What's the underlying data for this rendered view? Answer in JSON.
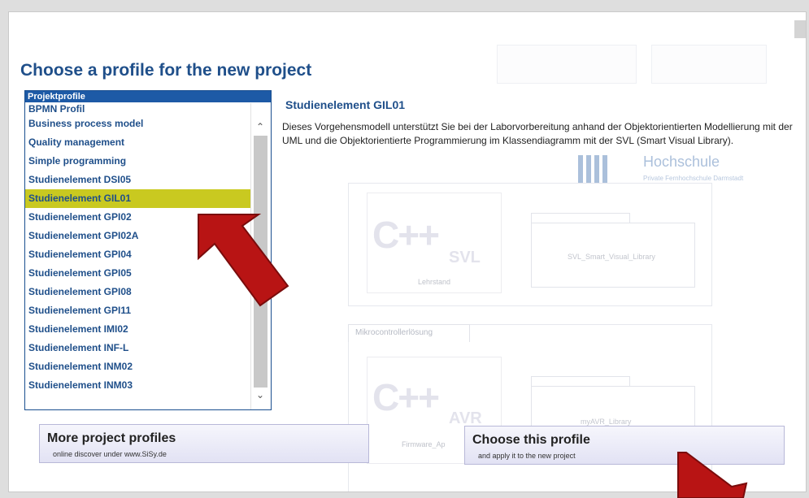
{
  "dialog": {
    "title": "Choose a profile for the new project"
  },
  "profile_list": {
    "header": "Projektprofile",
    "items": [
      "BPMN Profil",
      "Business process model",
      "Quality management",
      "Simple programming",
      "Studienelement DSI05",
      "Studienelement GIL01",
      "Studienelement GPI02",
      "Studienelement GPI02A",
      "Studienelement GPI04",
      "Studienelement GPI05",
      "Studienelement GPI08",
      "Studienelement GPI11",
      "Studienelement IMI02",
      "Studienelement INF-L",
      "Studienelement INM02",
      "Studienelement INM03"
    ],
    "selected": "Studienelement GIL01"
  },
  "detail": {
    "title": "Studienelement GIL01",
    "description": "Dieses Vorgehensmodell unterstützt Sie bei der Laborvorbereitung anhand der Objektorientierten Modellierung mit der UML und die Objektorientierte Programmierung im Klassendiagramm mit der SVL (Smart Visual Library)."
  },
  "watermark": {
    "name": "Hochschule",
    "subtitle": "Private Fernhochschule Darmstadt"
  },
  "preview": {
    "group2_tab": "Mikrocontrollerlösung",
    "tile1_label": "Lehrstand",
    "tile1_sub": "SVL",
    "folder1_label": "SVL_Smart_Visual_Library",
    "tile2_label": "Firmware_Ap",
    "tile2_sub": "AVR",
    "folder2_label": "myAVR_Library",
    "logo_text": "C++"
  },
  "buttons": {
    "more_profiles": {
      "label": "More project profiles",
      "sub": "online discover under www.SiSy.de"
    },
    "choose_profile": {
      "label": "Choose this profile",
      "sub": "and apply it to the new project"
    }
  },
  "colors": {
    "title": "#1f4f8a",
    "list_header": "#1d5aa6",
    "selection": "#c9c920",
    "arrow": "#b81414"
  }
}
